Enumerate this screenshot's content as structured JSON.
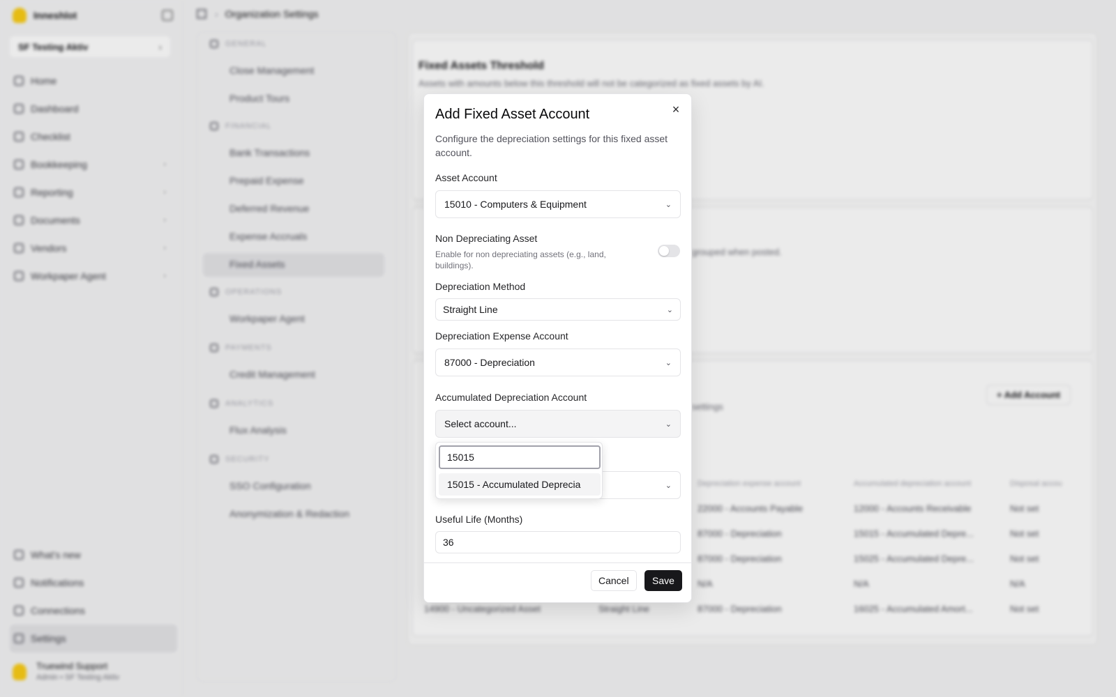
{
  "app": {
    "brand": "Inneshlot",
    "org": "SF Testing Aktiv",
    "breadcrumb": "Organization Settings",
    "nav": [
      "Home",
      "Dashboard",
      "Checklist",
      "Bookkeeping",
      "Reporting",
      "Documents",
      "Vendors",
      "Workpaper Agent"
    ],
    "nav_bottom": [
      "What's new",
      "Notifications",
      "Connections",
      "Settings"
    ],
    "user": {
      "name": "Truewind Support",
      "role": "Admin • SF Testing Aktiv"
    }
  },
  "settings_nav": {
    "groups": [
      {
        "title": "GENERAL",
        "items": [
          "Close Management",
          "Product Tours"
        ]
      },
      {
        "title": "FINANCIAL",
        "items": [
          "Bank Transactions",
          "Prepaid Expense",
          "Deferred Revenue",
          "Expense Accruals",
          "Fixed Assets"
        ]
      },
      {
        "title": "OPERATIONS",
        "items": [
          "Workpaper Agent"
        ]
      },
      {
        "title": "PAYMENTS",
        "items": [
          "Credit Management"
        ]
      },
      {
        "title": "ANALYTICS",
        "items": [
          "Flux Analysis"
        ]
      },
      {
        "title": "SECURITY",
        "items": [
          "SSO Configuration",
          "Anonymization & Redaction"
        ]
      }
    ]
  },
  "background": {
    "threshold_title": "Fixed Assets Threshold",
    "threshold_sub": "Assets with amounts below this threshold will not be categorized as fixed assets by AI.",
    "grouped_text": "grouped when posted.",
    "settings_text": "settings",
    "add_account": "+ Add Account",
    "table_headers": [
      "Depreciation expense account",
      "Accumulated depreciation account",
      "Disposal accou"
    ],
    "rows": [
      [
        "",
        "",
        "22000 - Accounts Payable",
        "12000 - Accounts Receivable",
        "Not set"
      ],
      [
        "",
        "",
        "87000 - Depreciation",
        "15015 - Accumulated Depre...",
        "Not set"
      ],
      [
        "",
        "",
        "87000 - Depreciation",
        "15025 - Accumulated Depre...",
        "Not set"
      ],
      [
        "",
        "",
        "N/A",
        "N/A",
        "N/A"
      ],
      [
        "14900 - Uncategorized Asset",
        "Straight Line",
        "87000 - Depreciation",
        "16025 - Accumulated Amort...",
        "Not set"
      ]
    ]
  },
  "modal": {
    "title": "Add Fixed Asset Account",
    "description": "Configure the depreciation settings for this fixed asset account.",
    "close_icon": "×",
    "asset_account_label": "Asset Account",
    "asset_account_value": "15010 - Computers & Equipment",
    "non_depreciating_label": "Non Depreciating Asset",
    "non_depreciating_hint": "Enable for non depreciating assets (e.g., land, buildings).",
    "non_depreciating_enabled": false,
    "method_label": "Depreciation Method",
    "method_value": "Straight Line",
    "expense_label": "Depreciation Expense Account",
    "expense_value": "87000 - Depreciation",
    "accum_label": "Accumulated Depreciation Account",
    "accum_placeholder": "Select account...",
    "useful_life_label": "Useful Life (Months)",
    "useful_life_value": "36",
    "cancel": "Cancel",
    "save": "Save"
  },
  "dropdown": {
    "search_value": "15015",
    "option": "15015 - Accumulated Deprecia"
  },
  "colors": {
    "primary": "#18181b",
    "border": "#e4e4e7",
    "muted": "#71717a"
  }
}
